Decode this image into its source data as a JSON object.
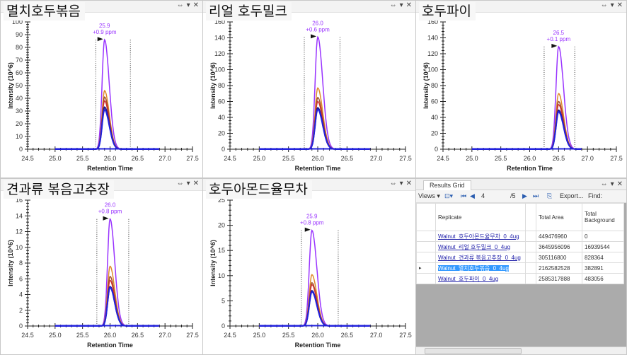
{
  "panel_controls": {
    "pin": "⇔",
    "dropdown": "▾",
    "close": "✕"
  },
  "charts": [
    {
      "title": "멸치호두볶음",
      "ylabel": "Intensity (10^6)",
      "xlabel": "Retention Time",
      "xlim": [
        24.5,
        27.5
      ],
      "ylim": [
        0,
        100
      ],
      "yticks": [
        0,
        10,
        20,
        30,
        40,
        50,
        60,
        70,
        80,
        90,
        100
      ],
      "xticks": [
        24.5,
        25.0,
        25.5,
        26.0,
        26.5,
        27.0,
        27.5
      ],
      "peak_rt": 25.9,
      "peak_label": "25.9",
      "ppm_label": "+0.9 ppm",
      "boundaries": [
        25.74,
        26.37
      ],
      "series": [
        {
          "name": "violet",
          "color": "#9933ff",
          "apex": 86
        },
        {
          "name": "orange",
          "color": "#e08a2a",
          "apex": 46
        },
        {
          "name": "brown",
          "color": "#a0522d",
          "apex": 41
        },
        {
          "name": "red",
          "color": "#d03030",
          "apex": 38
        },
        {
          "name": "navy",
          "color": "#1a1a8c",
          "apex": 33
        },
        {
          "name": "blue",
          "color": "#2222dd",
          "apex": 31
        }
      ]
    },
    {
      "title": "리얼 호두밀크",
      "ylabel": "Intensity (10^6)",
      "xlabel": "Retention Time",
      "xlim": [
        24.5,
        27.5
      ],
      "ylim": [
        0,
        160
      ],
      "yticks": [
        0,
        20,
        40,
        60,
        80,
        100,
        120,
        140,
        160
      ],
      "xticks": [
        24.5,
        25.0,
        25.5,
        26.0,
        26.5,
        27.0,
        27.5
      ],
      "peak_rt": 26.0,
      "peak_label": "26.0",
      "ppm_label": "+0.6 ppm",
      "boundaries": [
        25.77,
        26.38
      ],
      "series": [
        {
          "name": "violet",
          "color": "#9933ff",
          "apex": 141
        },
        {
          "name": "orange",
          "color": "#e08a2a",
          "apex": 77
        },
        {
          "name": "brown",
          "color": "#a0522d",
          "apex": 65
        },
        {
          "name": "red",
          "color": "#d03030",
          "apex": 60
        },
        {
          "name": "navy",
          "color": "#1a1a8c",
          "apex": 52
        },
        {
          "name": "blue",
          "color": "#2222dd",
          "apex": 50
        }
      ]
    },
    {
      "title": "호두파이",
      "ylabel": "Intensity (10^6)",
      "xlabel": "Retention Time",
      "xlim": [
        24.5,
        27.5
      ],
      "ylim": [
        0,
        160
      ],
      "yticks": [
        0,
        20,
        40,
        60,
        80,
        100,
        120,
        140,
        160
      ],
      "xticks": [
        24.5,
        25.0,
        25.5,
        26.0,
        26.5,
        27.0,
        27.5
      ],
      "peak_rt": 26.5,
      "peak_label": "26.5",
      "ppm_label": "+0.1 ppm",
      "boundaries": [
        26.25,
        26.78
      ],
      "series": [
        {
          "name": "violet",
          "color": "#9933ff",
          "apex": 129
        },
        {
          "name": "orange",
          "color": "#e08a2a",
          "apex": 70
        },
        {
          "name": "brown",
          "color": "#a0522d",
          "apex": 60
        },
        {
          "name": "red",
          "color": "#d03030",
          "apex": 56
        },
        {
          "name": "navy",
          "color": "#1a1a8c",
          "apex": 49
        },
        {
          "name": "blue",
          "color": "#2222dd",
          "apex": 47
        }
      ]
    },
    {
      "title": "견과류 볶음고추장",
      "ylabel": "Intensity (10^6)",
      "xlabel": "Retention Time",
      "xlim": [
        24.5,
        27.5
      ],
      "ylim": [
        0,
        16
      ],
      "yticks": [
        0,
        2,
        4,
        6,
        8,
        10,
        12,
        14,
        16
      ],
      "xticks": [
        24.5,
        25.0,
        25.5,
        26.0,
        26.5,
        27.0,
        27.5
      ],
      "peak_rt": 26.0,
      "peak_label": "26.0",
      "ppm_label": "+0.8 ppm",
      "boundaries": [
        25.76,
        26.34
      ],
      "series": [
        {
          "name": "violet",
          "color": "#9933ff",
          "apex": 13.6
        },
        {
          "name": "orange",
          "color": "#e08a2a",
          "apex": 7.6
        },
        {
          "name": "brown",
          "color": "#a0522d",
          "apex": 6.3
        },
        {
          "name": "red",
          "color": "#d03030",
          "apex": 5.8
        },
        {
          "name": "navy",
          "color": "#1a1a8c",
          "apex": 5.0
        },
        {
          "name": "blue",
          "color": "#2222dd",
          "apex": 4.9
        }
      ]
    },
    {
      "title": "호두아몬드율무차",
      "ylabel": "Intensity (10^6)",
      "xlabel": "Retention Time",
      "xlim": [
        24.5,
        27.5
      ],
      "ylim": [
        0,
        25
      ],
      "yticks": [
        0,
        5,
        10,
        15,
        20,
        25
      ],
      "xticks": [
        24.5,
        25.0,
        25.5,
        26.0,
        26.5,
        27.0,
        27.5
      ],
      "peak_rt": 25.9,
      "peak_label": "25.9",
      "ppm_label": "+0.8 ppm",
      "boundaries": [
        25.72,
        26.35
      ],
      "series": [
        {
          "name": "violet",
          "color": "#9933ff",
          "apex": 19
        },
        {
          "name": "orange",
          "color": "#e08a2a",
          "apex": 10.2
        },
        {
          "name": "brown",
          "color": "#a0522d",
          "apex": 8.6
        },
        {
          "name": "red",
          "color": "#d03030",
          "apex": 8.2
        },
        {
          "name": "navy",
          "color": "#1a1a8c",
          "apex": 7.0
        },
        {
          "name": "blue",
          "color": "#2222dd",
          "apex": 6.8
        }
      ]
    }
  ],
  "results_grid": {
    "tab_label": "Results Grid",
    "toolbar": {
      "views": "Views ▾",
      "page_current": "4",
      "page_total": "/5",
      "export": "Export...",
      "find": "Find:"
    },
    "columns": [
      "Replicate",
      "Total Area",
      "Total Background"
    ],
    "rows": [
      {
        "replicate": "Walnut_호두아몬드율무차_0_4ug",
        "total_area": "449476960",
        "total_background": "0",
        "selected": false
      },
      {
        "replicate": "Walnut_리얼 호두밀크_0_4ug",
        "total_area": "3645956096",
        "total_background": "16939544",
        "selected": false
      },
      {
        "replicate": "Walnut_견과류 볶음고추장_0_4ug",
        "total_area": "305116800",
        "total_background": "828364",
        "selected": false
      },
      {
        "replicate": "Walnut_멸치호두볶음_0_4ug",
        "total_area": "2162582528",
        "total_background": "382891",
        "selected": true
      },
      {
        "replicate": "Walnut_호두파이_0_4ug",
        "total_area": "2585317888",
        "total_background": "483056",
        "selected": false
      }
    ]
  },
  "chart_data": [
    {
      "type": "line",
      "title": "멸치호두볶음",
      "xlabel": "Retention Time",
      "ylabel": "Intensity (10^6)",
      "xlim": [
        24.5,
        27.5
      ],
      "ylim": [
        0,
        100
      ],
      "annotation": "25.9 +0.9 ppm",
      "series": [
        {
          "name": "violet",
          "peak_rt": 25.9,
          "apex": 86
        },
        {
          "name": "orange",
          "apex": 46
        },
        {
          "name": "brown",
          "apex": 41
        },
        {
          "name": "red",
          "apex": 38
        },
        {
          "name": "navy",
          "apex": 33
        },
        {
          "name": "blue",
          "apex": 31
        }
      ]
    },
    {
      "type": "line",
      "title": "리얼 호두밀크",
      "xlabel": "Retention Time",
      "ylabel": "Intensity (10^6)",
      "xlim": [
        24.5,
        27.5
      ],
      "ylim": [
        0,
        160
      ],
      "annotation": "26.0 +0.6 ppm",
      "series": [
        {
          "name": "violet",
          "peak_rt": 26.0,
          "apex": 141
        },
        {
          "name": "orange",
          "apex": 77
        },
        {
          "name": "brown",
          "apex": 65
        },
        {
          "name": "red",
          "apex": 60
        },
        {
          "name": "navy",
          "apex": 52
        },
        {
          "name": "blue",
          "apex": 50
        }
      ]
    },
    {
      "type": "line",
      "title": "호두파이",
      "xlabel": "Retention Time",
      "ylabel": "Intensity (10^6)",
      "xlim": [
        24.5,
        27.5
      ],
      "ylim": [
        0,
        160
      ],
      "annotation": "26.5 +0.1 ppm",
      "series": [
        {
          "name": "violet",
          "peak_rt": 26.5,
          "apex": 129
        },
        {
          "name": "orange",
          "apex": 70
        },
        {
          "name": "brown",
          "apex": 60
        },
        {
          "name": "red",
          "apex": 56
        },
        {
          "name": "navy",
          "apex": 49
        },
        {
          "name": "blue",
          "apex": 47
        }
      ]
    },
    {
      "type": "line",
      "title": "견과류 볶음고추장",
      "xlabel": "Retention Time",
      "ylabel": "Intensity (10^6)",
      "xlim": [
        24.5,
        27.5
      ],
      "ylim": [
        0,
        16
      ],
      "annotation": "26.0 +0.8 ppm",
      "series": [
        {
          "name": "violet",
          "peak_rt": 26.0,
          "apex": 13.6
        },
        {
          "name": "orange",
          "apex": 7.6
        },
        {
          "name": "brown",
          "apex": 6.3
        },
        {
          "name": "red",
          "apex": 5.8
        },
        {
          "name": "navy",
          "apex": 5.0
        },
        {
          "name": "blue",
          "apex": 4.9
        }
      ]
    },
    {
      "type": "line",
      "title": "호두아몬드율무차",
      "xlabel": "Retention Time",
      "ylabel": "Intensity (10^6)",
      "xlim": [
        24.5,
        27.5
      ],
      "ylim": [
        0,
        25
      ],
      "annotation": "25.9 +0.8 ppm",
      "series": [
        {
          "name": "violet",
          "peak_rt": 25.9,
          "apex": 19
        },
        {
          "name": "orange",
          "apex": 10.2
        },
        {
          "name": "brown",
          "apex": 8.6
        },
        {
          "name": "red",
          "apex": 8.2
        },
        {
          "name": "navy",
          "apex": 7.0
        },
        {
          "name": "blue",
          "apex": 6.8
        }
      ]
    }
  ]
}
